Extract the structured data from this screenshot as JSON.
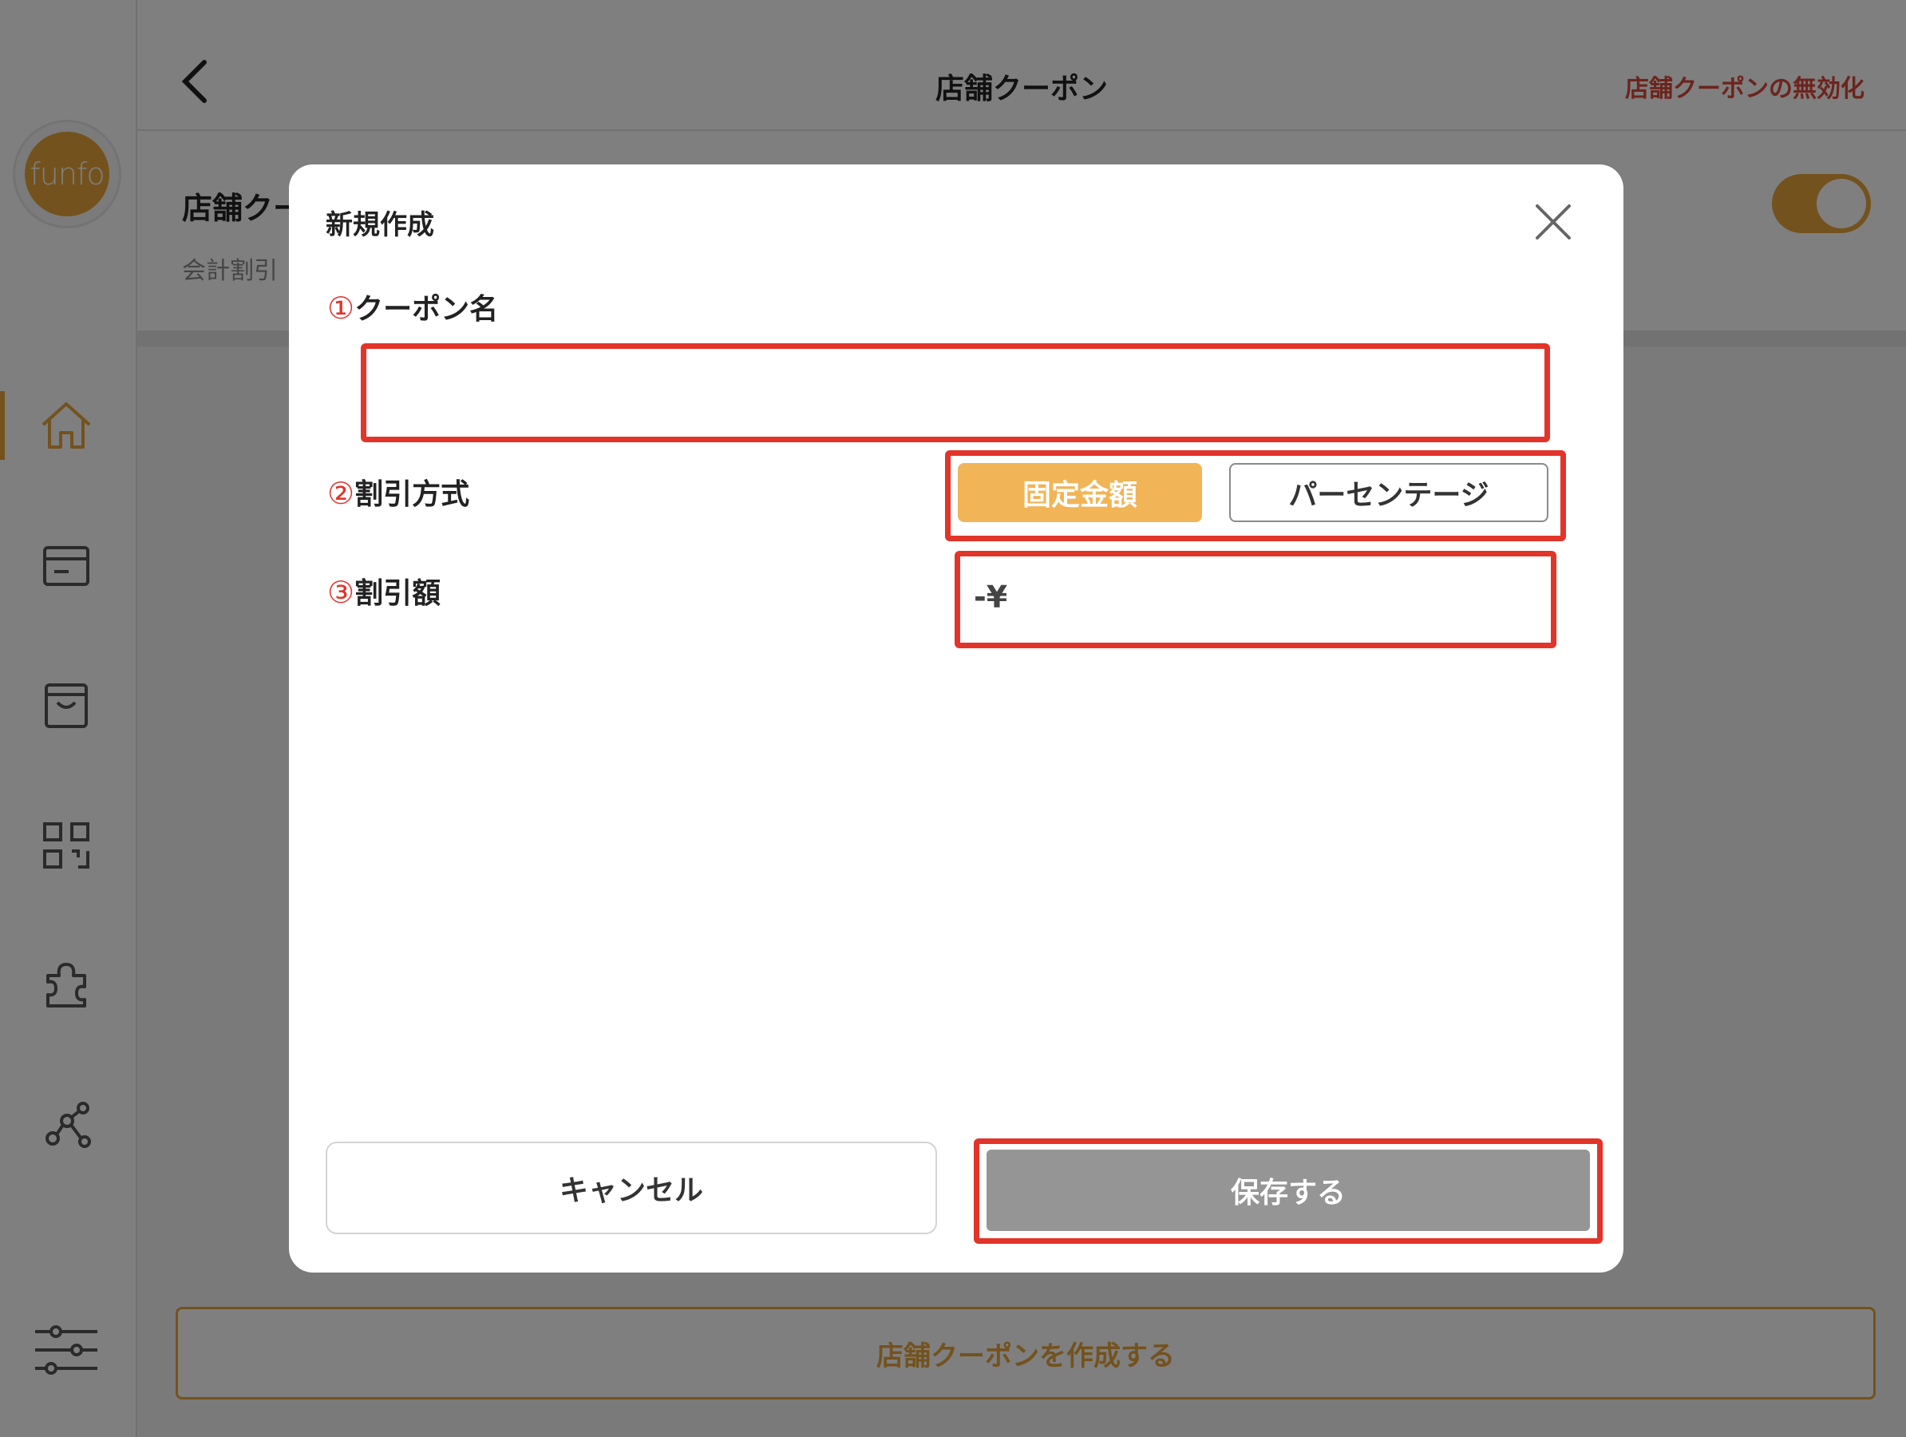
{
  "app": {
    "logo_text": "funfo",
    "page_title": "店舗クーポン",
    "disable_link": "店舗クーポンの無効化",
    "settings_title": "店舗クー",
    "settings_subtitle": "会計割引",
    "toggle_on": true,
    "create_button": "店舗クーポンを作成する",
    "sidebar_icons": [
      "home-icon",
      "card-icon",
      "box-icon",
      "qr-code-icon",
      "puzzle-icon",
      "network-icon",
      "sliders-icon"
    ]
  },
  "modal": {
    "title": "新規作成",
    "coupon_name": {
      "num": "①",
      "label": "クーポン名",
      "value": ""
    },
    "discount_type": {
      "num": "②",
      "label": "割引方式",
      "options": [
        "固定金額",
        "パーセンテージ"
      ],
      "selected": "固定金額"
    },
    "discount_amount": {
      "num": "③",
      "label": "割引額",
      "prefix": "-¥",
      "value": ""
    },
    "cancel_label": "キャンセル",
    "save_label": "保存する"
  },
  "colors": {
    "accent": "#e8a43c",
    "highlight": "#e3342a",
    "disabled_button": "#959595"
  }
}
